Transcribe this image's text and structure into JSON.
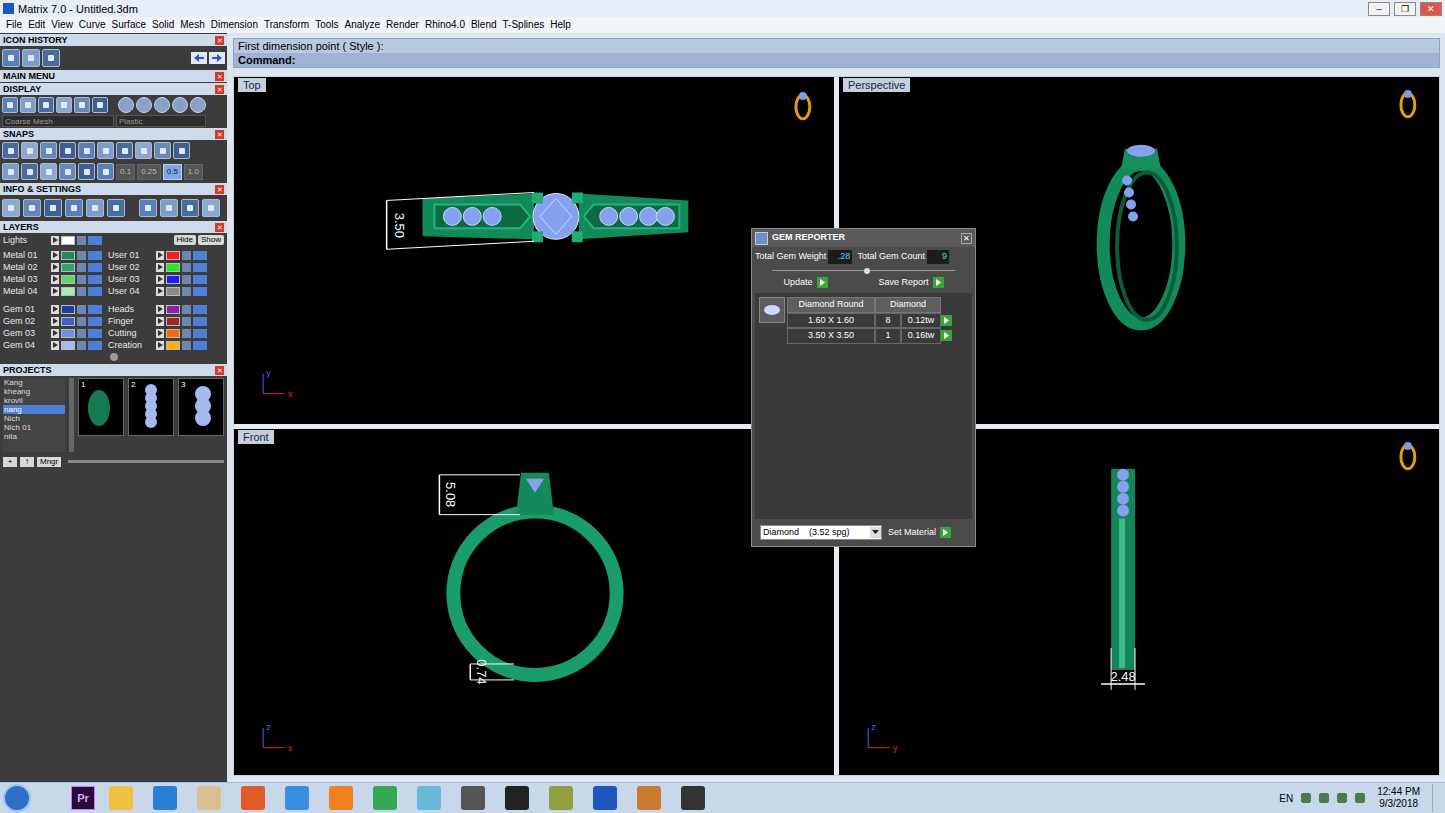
{
  "window": {
    "title": "Matrix 7.0 - Untitled.3dm",
    "controls": [
      "–",
      "❐",
      "✕"
    ]
  },
  "menu": [
    "File",
    "Edit",
    "View",
    "Curve",
    "Surface",
    "Solid",
    "Mesh",
    "Dimension",
    "Transform",
    "Tools",
    "Analyze",
    "Render",
    "Rhino4.0",
    "Blend",
    "T-Splines",
    "Help"
  ],
  "command": {
    "prompt": "First dimension point ( Style ):",
    "label": "Command:"
  },
  "panel": {
    "close_glyph": "✕",
    "sections": {
      "icon_history": "ICON HISTORY",
      "main_menu": "MAIN MENU",
      "display": "DISPLAY",
      "snaps": "SNAPS",
      "info": "INFO & SETTINGS",
      "layers": "LAYERS",
      "projects": "PROJECTS"
    },
    "display": {
      "mesh": "Coarse Mesh",
      "material": "Plastic"
    },
    "snap_values": [
      {
        "label": "0.1",
        "selected": false
      },
      {
        "label": "0.25",
        "selected": false
      },
      {
        "label": "0.5",
        "selected": true
      },
      {
        "label": "1.0",
        "selected": false
      }
    ],
    "layers": {
      "lights": {
        "name": "Lights",
        "color": "#ffffff"
      },
      "hide": "Hide",
      "show": "Show",
      "left_groups": [
        [
          {
            "name": "Metal 01",
            "color": "#1f8a5a"
          },
          {
            "name": "Metal 02",
            "color": "#2aa86a"
          },
          {
            "name": "Metal 03",
            "color": "#5ed66e"
          },
          {
            "name": "Metal 04",
            "color": "#a8eeb0"
          }
        ],
        [
          {
            "name": "Gem 01",
            "color": "#1c3f9e"
          },
          {
            "name": "Gem 02",
            "color": "#3a62d0"
          },
          {
            "name": "Gem 03",
            "color": "#7090e0"
          },
          {
            "name": "Gem 04",
            "color": "#a9b9ee"
          }
        ]
      ],
      "right_groups": [
        [
          {
            "name": "User 01",
            "color": "#ff1a1a"
          },
          {
            "name": "User 02",
            "color": "#22ee22"
          },
          {
            "name": "User 03",
            "color": "#1a1aff"
          },
          {
            "name": "User 04",
            "color": "#8a8a8a"
          }
        ],
        [
          {
            "name": "Heads",
            "color": "#8a22a8"
          },
          {
            "name": "Finger",
            "color": "#a82222"
          },
          {
            "name": "Cutting",
            "color": "#ff6a00"
          },
          {
            "name": "Creation",
            "color": "#ffb000"
          }
        ]
      ]
    },
    "projects": {
      "names": [
        {
          "name": "Kang",
          "selected": false
        },
        {
          "name": "kheang",
          "selected": false
        },
        {
          "name": "krovil",
          "selected": false
        },
        {
          "name": "nang",
          "selected": true
        },
        {
          "name": "Nich",
          "selected": false
        },
        {
          "name": "Nich 01",
          "selected": false
        },
        {
          "name": "nita",
          "selected": false
        }
      ],
      "thumbnails": [
        "1",
        "2",
        "3"
      ],
      "add": "+",
      "up": "↑",
      "manager": "Mngr"
    }
  },
  "viewports": [
    {
      "label": "Top",
      "kind": "top",
      "dimensions": [
        "3.50"
      ],
      "axes": [
        "y",
        "x"
      ]
    },
    {
      "label": "Perspective",
      "kind": "perspective",
      "dimensions": [],
      "axes": []
    },
    {
      "label": "Front",
      "kind": "front",
      "dimensions": [
        "5.08",
        "0.74"
      ],
      "axes": [
        "z",
        "x"
      ]
    },
    {
      "label": "",
      "kind": "right",
      "dimensions": [
        "2.48"
      ],
      "axes": [
        "z",
        "y"
      ]
    }
  ],
  "gem_reporter": {
    "title": "GEM REPORTER",
    "close": "✕",
    "weight_label": "Total Gem Weight",
    "weight": ".28",
    "count_label": "Total Gem Count",
    "count": "9",
    "update": "Update",
    "save": "Save Report",
    "columns": [
      "Diamond Round",
      "Diamond"
    ],
    "rows": [
      {
        "size": "1.60 X 1.60",
        "count": "8",
        "weight": "0.12tw"
      },
      {
        "size": "3.50 X 3.50",
        "count": "1",
        "weight": "0.16tw"
      }
    ],
    "material": "Diamond    (3.52 spg)",
    "set_material": "Set Material"
  },
  "taskbar": {
    "app_badge": "Pr",
    "language": "EN",
    "time": "12:44 PM",
    "date": "9/3/2018"
  }
}
